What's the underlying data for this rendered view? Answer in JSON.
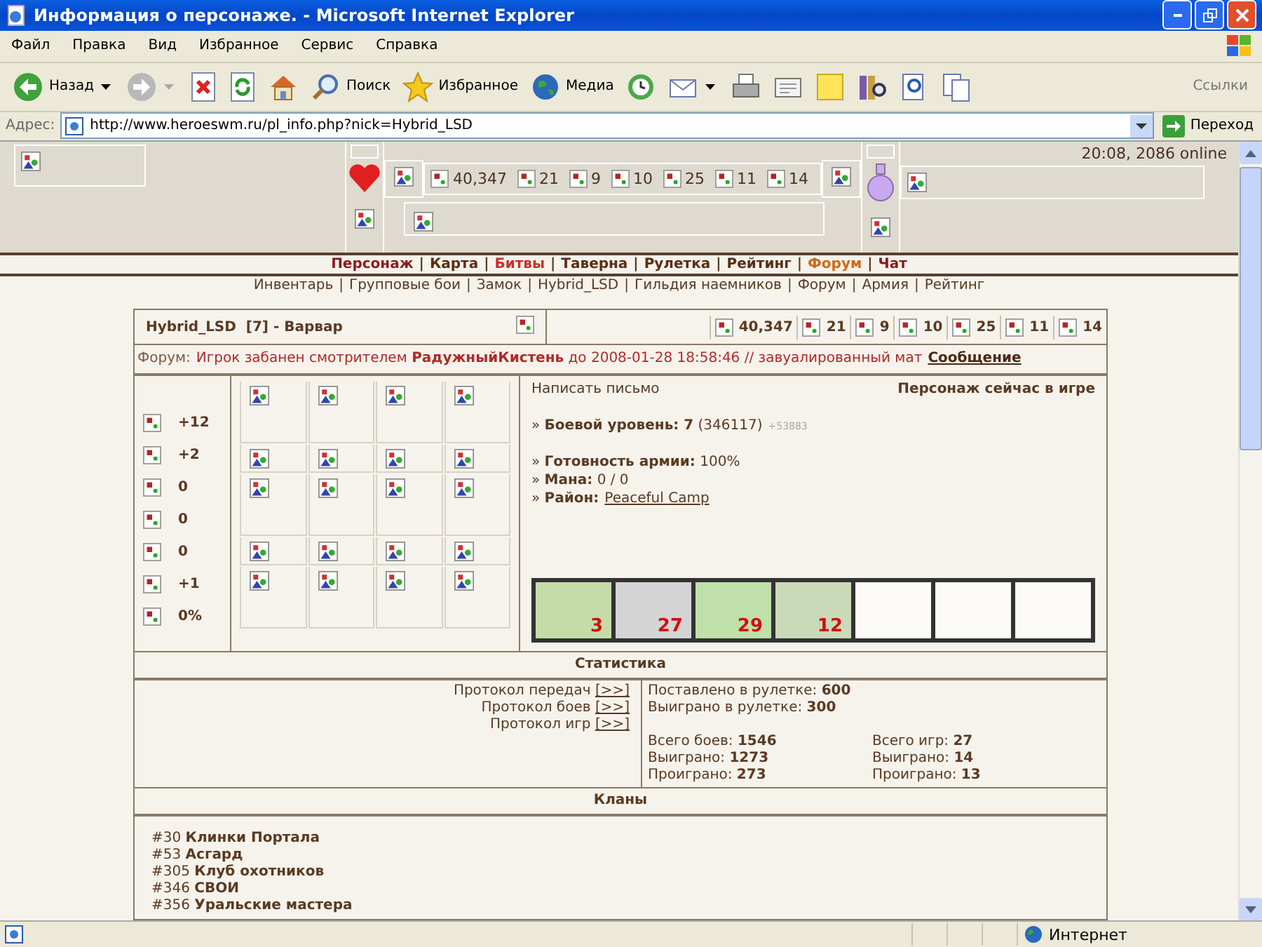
{
  "window": {
    "title": "Информация о персонаже. - Microsoft Internet Explorer"
  },
  "menu": [
    "Файл",
    "Правка",
    "Вид",
    "Избранное",
    "Сервис",
    "Справка"
  ],
  "toolbar": [
    {
      "kind": "back",
      "label": "Назад",
      "dropdown": true
    },
    {
      "kind": "forward",
      "dropdown": true
    },
    {
      "kind": "stop"
    },
    {
      "kind": "refresh"
    },
    {
      "kind": "home"
    },
    {
      "kind": "search",
      "label": "Поиск"
    },
    {
      "kind": "favorites",
      "label": "Избранное"
    },
    {
      "kind": "media",
      "label": "Медиа"
    },
    {
      "kind": "history"
    },
    {
      "kind": "mail",
      "dropdown": true
    },
    {
      "kind": "print"
    },
    {
      "kind": "edit"
    },
    {
      "kind": "note"
    },
    {
      "kind": "library"
    },
    {
      "kind": "find"
    },
    {
      "kind": "copy"
    }
  ],
  "links": "Ссылки",
  "address": {
    "label": "Адрес:",
    "url": "http://www.heroeswm.ru/pl_info.php?nick=Hybrid_LSD",
    "go": "Переход"
  },
  "top_panel": {
    "clock": "20:08, 2086 online",
    "resources": [
      "40,347",
      "21",
      "9",
      "10",
      "25",
      "11",
      "14"
    ]
  },
  "nav_separator": "|",
  "info_bullet": "»",
  "nav_primary": [
    {
      "label": "Персонаж",
      "color": "#8b1c1c"
    },
    {
      "label": "Карта",
      "color": "#5a2e14"
    },
    {
      "label": "Битвы",
      "color": "#c8302c"
    },
    {
      "label": "Таверна",
      "color": "#5a2e14"
    },
    {
      "label": "Рулетка",
      "color": "#5a2e14"
    },
    {
      "label": "Рейтинг",
      "color": "#5a2e14"
    },
    {
      "label": "Форум",
      "color": "#d06a1c"
    },
    {
      "label": "Чат",
      "color": "#8b1c1c"
    }
  ],
  "nav_secondary": [
    "Инвентарь",
    "Групповые бои",
    "Замок",
    "Hybrid_LSD",
    "Гильдия наемников",
    "Форум",
    "Армия",
    "Рейтинг"
  ],
  "profile": {
    "name": "Hybrid_LSD  [7] - Варвар",
    "resources": [
      "40,347",
      "21",
      "9",
      "10",
      "25",
      "11",
      "14"
    ],
    "ban": {
      "label": "Форум:",
      "text": "Игрок забанен смотрителем **РадужныйКистень** до 2008-01-28 18:58:46 // завуалированный мат",
      "link": "Сообщение"
    },
    "stats": [
      "+12",
      "+2",
      "0",
      "0",
      "0",
      "+1",
      "0%"
    ],
    "write_letter": "Написать письмо",
    "online_status": "Персонаж сейчас в игре",
    "info": [
      {
        "kind": "level",
        "label": "Боевой уровень:",
        "value": "7",
        "extra": "(346117)",
        "delta": "+53883"
      },
      {
        "kind": "text",
        "label": "Готовность армии:",
        "value": "100%"
      },
      {
        "kind": "text",
        "label": "Мана:",
        "value": "0 / 0"
      },
      {
        "kind": "link",
        "label": "Район:",
        "value": "Peaceful Camp"
      }
    ],
    "army": [
      {
        "kind": "unit",
        "count": "3"
      },
      {
        "kind": "unit",
        "count": "27"
      },
      {
        "kind": "unit",
        "count": "29"
      },
      {
        "kind": "unit",
        "count": "12"
      },
      {
        "kind": "empty"
      },
      {
        "kind": "empty"
      },
      {
        "kind": "empty"
      }
    ]
  },
  "statistics": {
    "title": "Статистика",
    "protocols": [
      {
        "label": "Протокол передач",
        "link": "[>>]"
      },
      {
        "label": "Протокол боев",
        "link": "[>>]"
      },
      {
        "label": "Протокол игр",
        "link": "[>>]"
      }
    ],
    "roulette": [
      {
        "label": "Поставлено в рулетке:",
        "value": "600"
      },
      {
        "label": "Выиграно в рулетке:",
        "value": "300"
      }
    ],
    "battles": [
      {
        "label": "Всего боев:",
        "value": "1546"
      },
      {
        "label": "Выиграно:",
        "value": "1273"
      },
      {
        "label": "Проиграно:",
        "value": "273"
      }
    ],
    "games": [
      {
        "label": "Всего игр:",
        "value": "27"
      },
      {
        "label": "Выиграно:",
        "value": "14"
      },
      {
        "label": "Проиграно:",
        "value": "13"
      }
    ]
  },
  "clans": {
    "title": "Кланы",
    "items": [
      {
        "number": "#30",
        "name": "Клинки Портала"
      },
      {
        "number": "#53",
        "name": "Асгард"
      },
      {
        "number": "#305",
        "name": "Клуб охотников"
      },
      {
        "number": "#346",
        "name": "СВОИ"
      },
      {
        "number": "#356",
        "name": "Уральские мастера"
      }
    ]
  },
  "status_bar": {
    "zone": "Интернет"
  }
}
